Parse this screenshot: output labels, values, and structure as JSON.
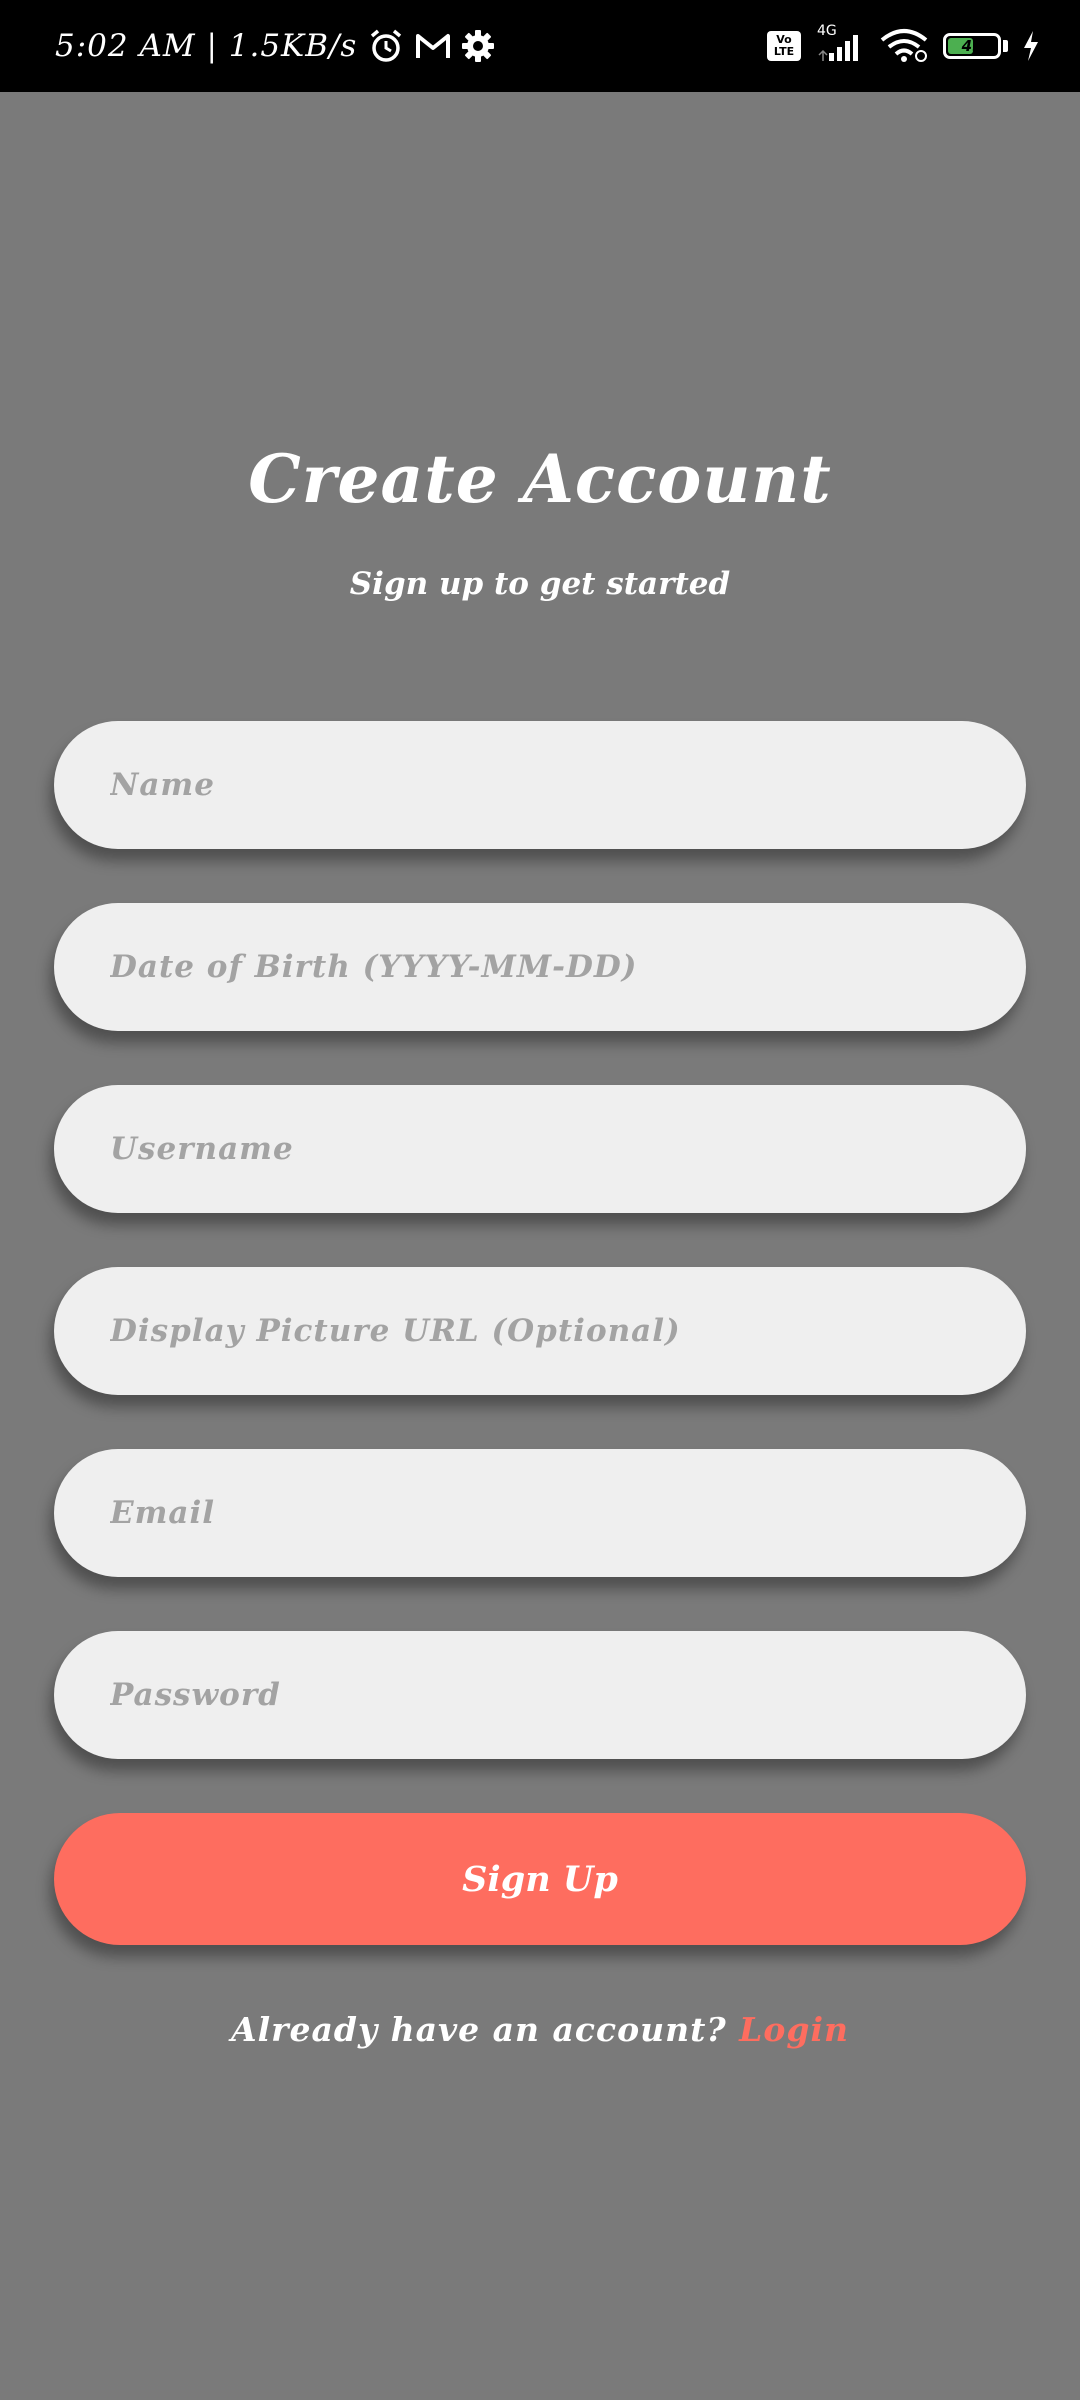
{
  "status_bar": {
    "time_speed": "5:02 AM | 1.5KB/s",
    "network_type": "4G",
    "volte_top": "Vo",
    "volte_bottom": "LTE",
    "battery_level": "49",
    "battery_fraction": 0.49,
    "icons": [
      "alarm-icon",
      "gmail-icon",
      "settings-gear-icon",
      "volte-icon",
      "signal-icon",
      "wifi-icon",
      "battery-icon",
      "charging-icon"
    ]
  },
  "header": {
    "title": "Create Account",
    "subtitle": "Sign up to get started"
  },
  "form": {
    "fields": [
      {
        "name": "name-input",
        "placeholder": "Name",
        "value": ""
      },
      {
        "name": "dob-input",
        "placeholder": "Date of Birth (YYYY-MM-DD)",
        "value": ""
      },
      {
        "name": "username-input",
        "placeholder": "Username",
        "value": ""
      },
      {
        "name": "display-picture-url-input",
        "placeholder": "Display Picture URL (Optional)",
        "value": ""
      },
      {
        "name": "email-input",
        "placeholder": "Email",
        "value": ""
      },
      {
        "name": "password-input",
        "placeholder": "Password",
        "value": ""
      }
    ],
    "submit_label": "Sign Up"
  },
  "footer": {
    "prompt": "Already have an account?",
    "login_label": "Login"
  },
  "colors": {
    "background": "#7a7a7a",
    "accent": "#fe6d5f",
    "field_bg": "#efefef",
    "placeholder": "#a3a3a3"
  }
}
